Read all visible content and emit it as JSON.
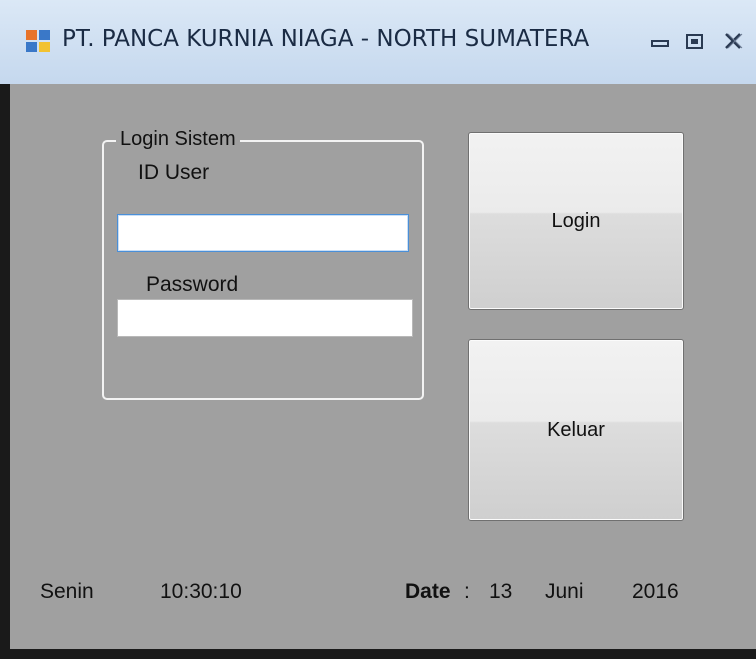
{
  "window": {
    "title": "PT. PANCA KURNIA NIAGA - NORTH SUMATERA",
    "icon": "form-window-icon",
    "controls": {
      "minimize": "minimize-icon",
      "maximize": "maximize-icon",
      "close": "close-icon"
    }
  },
  "login_group": {
    "title": "Login Sistem",
    "user_label": "ID User",
    "user_value": "",
    "password_label": "Password",
    "password_value": ""
  },
  "buttons": {
    "login": "Login",
    "exit": "Keluar"
  },
  "status_bar": {
    "day": "Senin",
    "time": "10:30:10",
    "date_label": "Date",
    "separator": ":",
    "day_of_month": "13",
    "month": "Juni",
    "year": "2016"
  },
  "colors": {
    "background": "#a0a0a0",
    "titlebar": "#c5d8ee",
    "border": "#1a1a1a"
  }
}
